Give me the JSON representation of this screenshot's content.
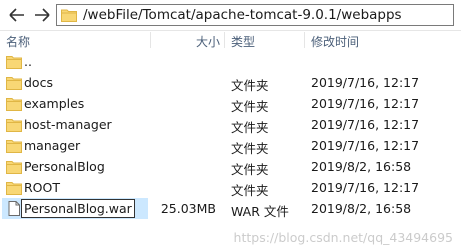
{
  "address_bar": {
    "path": "/webFile/Tomcat/apache-tomcat-9.0.1/webapps"
  },
  "columns": {
    "name": "名称",
    "size": "大小",
    "type": "类型",
    "modified": "修改时间"
  },
  "rows": [
    {
      "name": "..",
      "size": "",
      "type": "",
      "modified": "",
      "icon": "folder-icon"
    },
    {
      "name": "docs",
      "size": "",
      "type": "文件夹",
      "modified": "2019/7/16, 12:17",
      "icon": "folder-icon"
    },
    {
      "name": "examples",
      "size": "",
      "type": "文件夹",
      "modified": "2019/7/16, 12:17",
      "icon": "folder-icon"
    },
    {
      "name": "host-manager",
      "size": "",
      "type": "文件夹",
      "modified": "2019/7/16, 12:17",
      "icon": "folder-icon"
    },
    {
      "name": "manager",
      "size": "",
      "type": "文件夹",
      "modified": "2019/7/16, 12:17",
      "icon": "folder-icon"
    },
    {
      "name": "PersonalBlog",
      "size": "",
      "type": "文件夹",
      "modified": "2019/8/2, 16:58",
      "icon": "folder-icon"
    },
    {
      "name": "ROOT",
      "size": "",
      "type": "文件夹",
      "modified": "2019/7/16, 12:17",
      "icon": "folder-icon"
    },
    {
      "name": "PersonalBlog.war",
      "size": "25.03MB",
      "type": "WAR 文件",
      "modified": "2019/8/2, 16:58",
      "icon": "file-icon"
    }
  ],
  "watermark": "https://blog.csdn.net/qq_43494695",
  "colors": {
    "folder": "#f8d775",
    "folder_dark": "#e0b645",
    "selection": "#cce8ff",
    "header_text": "#4c607a"
  }
}
